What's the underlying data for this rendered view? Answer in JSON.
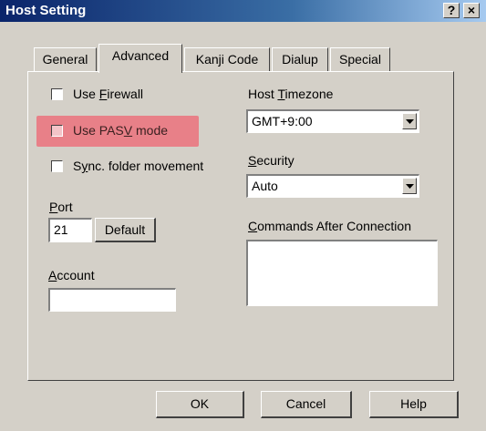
{
  "window": {
    "title": "Host Setting",
    "help_glyph": "?",
    "close_glyph": "×"
  },
  "tabs": [
    {
      "label": "General"
    },
    {
      "label": "Advanced"
    },
    {
      "label": "Kanji Code"
    },
    {
      "label": "Dialup"
    },
    {
      "label": "Special"
    }
  ],
  "options": {
    "firewall": {
      "pre": "Use ",
      "key": "F",
      "post": "irewall",
      "checked": false
    },
    "pasv": {
      "pre": "Use PAS",
      "key": "V",
      "post": " mode",
      "checked": false,
      "highlight_color": "#e88088"
    },
    "sync": {
      "pre": "S",
      "key": "y",
      "post": "nc. folder movement",
      "checked": false
    }
  },
  "port": {
    "key": "P",
    "rest": "ort",
    "value": "21",
    "default_label": "Default"
  },
  "account": {
    "key": "A",
    "rest": "ccount",
    "value": ""
  },
  "timezone": {
    "pre": "Host ",
    "key": "T",
    "post": "imezone",
    "value": "GMT+9:00"
  },
  "security": {
    "key": "S",
    "rest": "ecurity",
    "value": "Auto"
  },
  "commands": {
    "key": "C",
    "rest": "ommands After Connection",
    "value": ""
  },
  "buttons": {
    "ok": "OK",
    "cancel": "Cancel",
    "help": "Help"
  }
}
